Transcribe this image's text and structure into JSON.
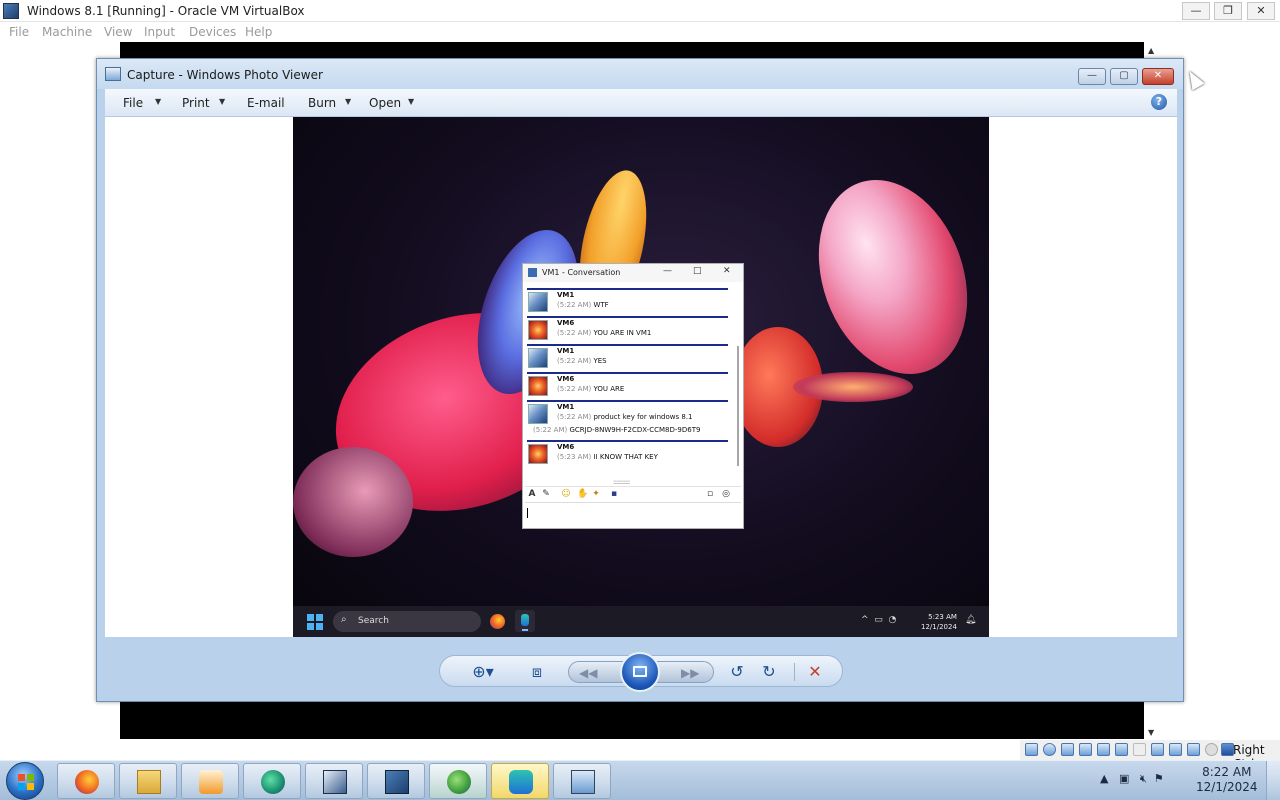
{
  "vbox": {
    "title": "Windows 8.1 [Running] - Oracle VM VirtualBox",
    "menu": [
      "File",
      "Machine",
      "View",
      "Input",
      "Devices",
      "Help"
    ],
    "status_host_key": "Right Ctrl"
  },
  "photo_viewer": {
    "title": "Capture - Windows Photo Viewer",
    "toolbar": {
      "file": "File",
      "print": "Print",
      "email": "E-mail",
      "burn": "Burn",
      "open": "Open"
    },
    "help": "?"
  },
  "conversation": {
    "title": "VM1 - Conversation",
    "messages": [
      {
        "name": "VM1",
        "time": "(5:22 AM)",
        "text": "WTF",
        "avatar": "vm1"
      },
      {
        "name": "VM6",
        "time": "(5:22 AM)",
        "text": "YOU ARE IN VM1",
        "avatar": "vm6"
      },
      {
        "name": "VM1",
        "time": "(5:22 AM)",
        "text": "YES",
        "avatar": "vm1"
      },
      {
        "name": "VM6",
        "time": "(5:22 AM)",
        "text": "YOU ARE",
        "avatar": "vm6"
      },
      {
        "name": "VM1",
        "time": "(5:22 AM)",
        "text": "product key for windows 8.1",
        "avatar": "vm1"
      },
      {
        "name": "VM6",
        "time": "(5:23 AM)",
        "text": "II KNOW THAT KEY",
        "avatar": "vm6"
      }
    ],
    "key_line": {
      "time": "(5:22 AM)",
      "text": "GCRJD-8NW9H-F2CDX-CCM8D-9D6T9"
    }
  },
  "w11_taskbar": {
    "search": "Search",
    "time": "5:23 AM",
    "date": "12/1/2024"
  },
  "host_taskbar": {
    "time": "8:22 AM",
    "date": "12/1/2024",
    "pinned": [
      "firefox-icon",
      "file-explorer-icon",
      "media-player-icon",
      "edge-icon",
      "virtualbox-icon",
      "windows-81-vm-icon",
      "network-globe-icon",
      "messenger-icon",
      "photo-viewer-icon"
    ]
  },
  "colors": {
    "accent": "#1f4f8f",
    "conversation_separator": "#1a2b8a",
    "close_red": "#c4402b"
  }
}
